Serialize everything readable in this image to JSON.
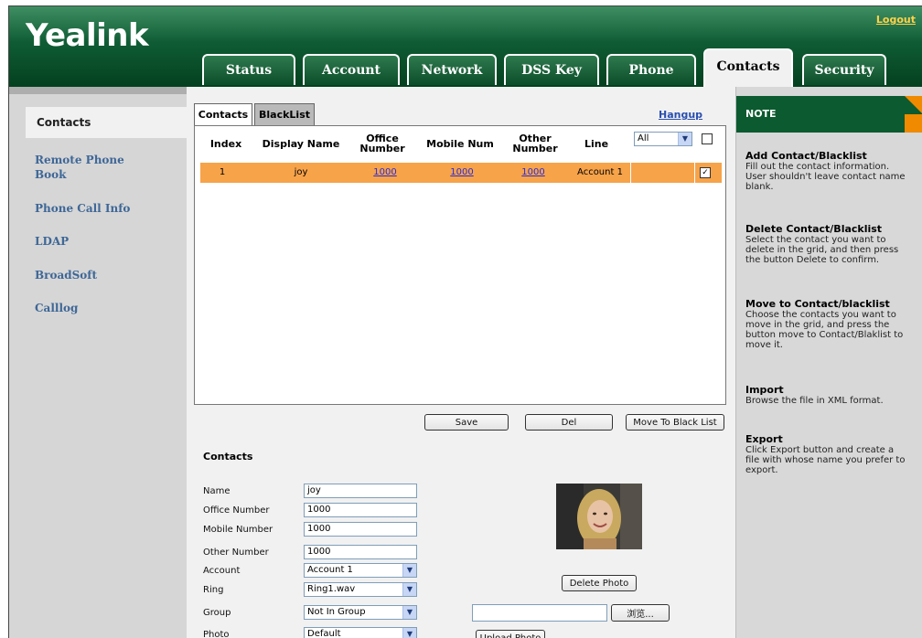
{
  "header": {
    "logo": "Yealink",
    "logout": "Logout"
  },
  "tabs": [
    {
      "label": "Status"
    },
    {
      "label": "Account"
    },
    {
      "label": "Network"
    },
    {
      "label": "DSS Key"
    },
    {
      "label": "Phone"
    },
    {
      "label": "Contacts"
    },
    {
      "label": "Security"
    }
  ],
  "sidebar": {
    "active": "Contacts",
    "items": [
      "Remote Phone Book",
      "Phone Call Info",
      "LDAP",
      "BroadSoft",
      "Calllog"
    ]
  },
  "subtabs": {
    "contacts": "Contacts",
    "blacklist": "BlackList",
    "hangup": "Hangup"
  },
  "grid": {
    "headers": [
      "Index",
      "Display Name",
      "Office Number",
      "Mobile Num",
      "Other Number",
      "Line"
    ],
    "line_filter": "All",
    "rows": [
      {
        "index": "1",
        "name": "joy",
        "office": "1000",
        "mobile": "1000",
        "other": "1000",
        "line": "Account 1",
        "checked": "✓"
      }
    ]
  },
  "buttons": {
    "save": "Save",
    "del": "Del",
    "move": "Move To Black List",
    "delete_photo": "Delete Photo",
    "browse": "浏览...",
    "upload": "Upload Photo"
  },
  "form": {
    "title": "Contacts",
    "name_label": "Name",
    "name": "joy",
    "office_label": "Office Number",
    "office": "1000",
    "mobile_label": "Mobile Number",
    "mobile": "1000",
    "other_label": "Other Number",
    "other": "1000",
    "account_label": "Account",
    "account": "Account 1",
    "ring_label": "Ring",
    "ring": "Ring1.wav",
    "group_label": "Group",
    "group": "Not In Group",
    "photo_label": "Photo",
    "photo": "Default"
  },
  "note": {
    "title": "NOTE",
    "sections": [
      {
        "title": "Add Contact/Blacklist",
        "text": "Fill out the contact information. User shouldn't leave contact name blank."
      },
      {
        "title": "Delete Contact/Blacklist",
        "text": "Select the contact you want to delete in the grid, and then press the button Delete to confirm."
      },
      {
        "title": "Move to Contact/blacklist",
        "text": "Choose the contacts you want to move in the grid, and press the button move to Contact/Blaklist to move it."
      },
      {
        "title": "Import",
        "text": "Browse the file in XML format."
      },
      {
        "title": "Export",
        "text": "Click Export button and create a file with whose name you prefer to export."
      }
    ]
  },
  "colors": {
    "header_green": "#0c5a2f",
    "row_highlight": "#f7a34a",
    "accent_orange": "#f08a00",
    "sidebar_link": "#3e6797"
  }
}
